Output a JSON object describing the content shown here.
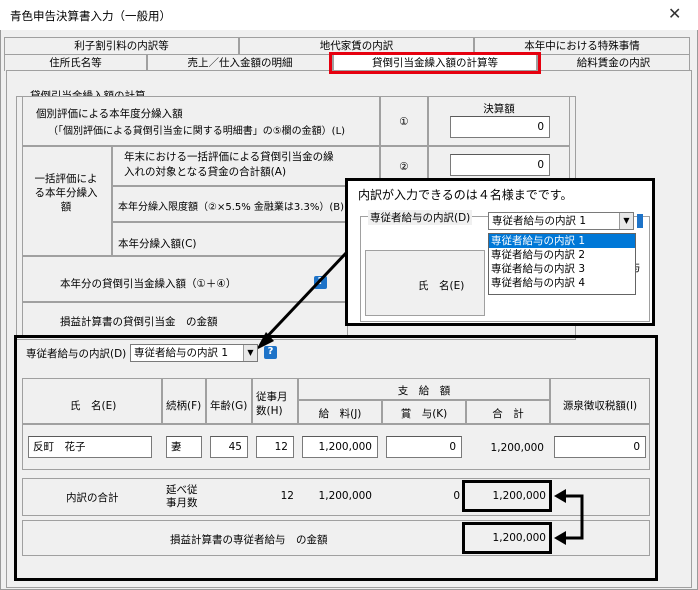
{
  "window": {
    "title": "青色申告決算書入力（一般用）",
    "close": "✕"
  },
  "tabs": {
    "row1": [
      "利子割引料の内訳等",
      "地代家賃の内訳",
      "本年中における特殊事情"
    ],
    "row2": [
      "住所氏名等",
      "売上／仕入金額の明細",
      "貸倒引当金繰入額の計算等",
      "給料賃金の内訳"
    ]
  },
  "bad_debt": {
    "group_title": "貸倒引当金繰入額の計算",
    "kobetsu_label": "個別評価による本年度分繰入額",
    "kobetsu_sub": "（「個別評価による貸倒引当金に関する明細書」の⑤欄の金額）(L)",
    "marks": [
      "①",
      "②",
      "③",
      "④"
    ],
    "amount_header": "決算額",
    "amount1": "0",
    "amount2": "0",
    "ikkatsu_label": "一括評価による本年分繰入額",
    "row2_label": "年末における一括評価による貸倒引当金の繰入れの対象となる貸金の合計額(A)",
    "row3_label": "本年分繰入限度額（②×5.5% 金融業は3.3%）(B)",
    "row4_label": "本年分繰入額(C)",
    "total_label": "本年分の貸倒引当金繰入額（①＋④）",
    "pl_label": "損益計算書の貸倒引当金　の金額"
  },
  "callout": {
    "text": "内訳が入力できるのは４名様までです。",
    "label": "専従者給与の内訳(D)",
    "selected": "専従者給与の内訳 1",
    "options": [
      "専従者給与の内訳 1",
      "専従者給与の内訳 2",
      "専従者給与の内訳 3",
      "専従者給与の内訳 4"
    ],
    "name_header": "氏　名(E)",
    "cut_text": "与"
  },
  "family": {
    "label": "専従者給与の内訳(D)",
    "selected": "専従者給与の内訳 1",
    "headers": {
      "name": "氏　名(E)",
      "relation": "続柄(F)",
      "age": "年齢(G)",
      "months": "従事月数(H)",
      "payment": "支　給　額",
      "salary": "給　料(J)",
      "bonus": "賞　与(K)",
      "total": "合　計",
      "tax": "源泉徴収税額(I)"
    },
    "row": {
      "name": "反町　花子",
      "relation": "妻",
      "age": "45",
      "months": "12",
      "salary": "1,200,000",
      "bonus": "0",
      "total": "1,200,000",
      "tax": "0"
    },
    "sum": {
      "label": "内訳の合計",
      "months_label": "延べ従事月数",
      "months": "12",
      "salary": "1,200,000",
      "bonus": "0",
      "total": "1,200,000"
    },
    "pl": {
      "label": "損益計算書の専従者給与　の金額",
      "value": "1,200,000"
    }
  },
  "help_icon": "?"
}
